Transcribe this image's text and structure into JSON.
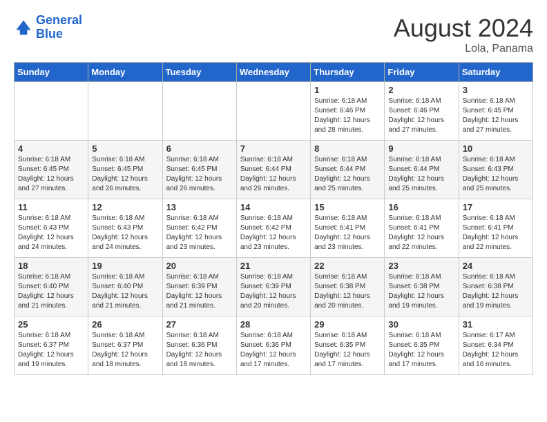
{
  "header": {
    "logo_line1": "General",
    "logo_line2": "Blue",
    "month": "August 2024",
    "location": "Lola, Panama"
  },
  "days_of_week": [
    "Sunday",
    "Monday",
    "Tuesday",
    "Wednesday",
    "Thursday",
    "Friday",
    "Saturday"
  ],
  "weeks": [
    [
      {
        "day": "",
        "info": ""
      },
      {
        "day": "",
        "info": ""
      },
      {
        "day": "",
        "info": ""
      },
      {
        "day": "",
        "info": ""
      },
      {
        "day": "1",
        "info": "Sunrise: 6:18 AM\nSunset: 6:46 PM\nDaylight: 12 hours\nand 28 minutes."
      },
      {
        "day": "2",
        "info": "Sunrise: 6:18 AM\nSunset: 6:46 PM\nDaylight: 12 hours\nand 27 minutes."
      },
      {
        "day": "3",
        "info": "Sunrise: 6:18 AM\nSunset: 6:45 PM\nDaylight: 12 hours\nand 27 minutes."
      }
    ],
    [
      {
        "day": "4",
        "info": "Sunrise: 6:18 AM\nSunset: 6:45 PM\nDaylight: 12 hours\nand 27 minutes."
      },
      {
        "day": "5",
        "info": "Sunrise: 6:18 AM\nSunset: 6:45 PM\nDaylight: 12 hours\nand 26 minutes."
      },
      {
        "day": "6",
        "info": "Sunrise: 6:18 AM\nSunset: 6:45 PM\nDaylight: 12 hours\nand 26 minutes."
      },
      {
        "day": "7",
        "info": "Sunrise: 6:18 AM\nSunset: 6:44 PM\nDaylight: 12 hours\nand 26 minutes."
      },
      {
        "day": "8",
        "info": "Sunrise: 6:18 AM\nSunset: 6:44 PM\nDaylight: 12 hours\nand 25 minutes."
      },
      {
        "day": "9",
        "info": "Sunrise: 6:18 AM\nSunset: 6:44 PM\nDaylight: 12 hours\nand 25 minutes."
      },
      {
        "day": "10",
        "info": "Sunrise: 6:18 AM\nSunset: 6:43 PM\nDaylight: 12 hours\nand 25 minutes."
      }
    ],
    [
      {
        "day": "11",
        "info": "Sunrise: 6:18 AM\nSunset: 6:43 PM\nDaylight: 12 hours\nand 24 minutes."
      },
      {
        "day": "12",
        "info": "Sunrise: 6:18 AM\nSunset: 6:43 PM\nDaylight: 12 hours\nand 24 minutes."
      },
      {
        "day": "13",
        "info": "Sunrise: 6:18 AM\nSunset: 6:42 PM\nDaylight: 12 hours\nand 23 minutes."
      },
      {
        "day": "14",
        "info": "Sunrise: 6:18 AM\nSunset: 6:42 PM\nDaylight: 12 hours\nand 23 minutes."
      },
      {
        "day": "15",
        "info": "Sunrise: 6:18 AM\nSunset: 6:41 PM\nDaylight: 12 hours\nand 23 minutes."
      },
      {
        "day": "16",
        "info": "Sunrise: 6:18 AM\nSunset: 6:41 PM\nDaylight: 12 hours\nand 22 minutes."
      },
      {
        "day": "17",
        "info": "Sunrise: 6:18 AM\nSunset: 6:41 PM\nDaylight: 12 hours\nand 22 minutes."
      }
    ],
    [
      {
        "day": "18",
        "info": "Sunrise: 6:18 AM\nSunset: 6:40 PM\nDaylight: 12 hours\nand 21 minutes."
      },
      {
        "day": "19",
        "info": "Sunrise: 6:18 AM\nSunset: 6:40 PM\nDaylight: 12 hours\nand 21 minutes."
      },
      {
        "day": "20",
        "info": "Sunrise: 6:18 AM\nSunset: 6:39 PM\nDaylight: 12 hours\nand 21 minutes."
      },
      {
        "day": "21",
        "info": "Sunrise: 6:18 AM\nSunset: 6:39 PM\nDaylight: 12 hours\nand 20 minutes."
      },
      {
        "day": "22",
        "info": "Sunrise: 6:18 AM\nSunset: 6:38 PM\nDaylight: 12 hours\nand 20 minutes."
      },
      {
        "day": "23",
        "info": "Sunrise: 6:18 AM\nSunset: 6:38 PM\nDaylight: 12 hours\nand 19 minutes."
      },
      {
        "day": "24",
        "info": "Sunrise: 6:18 AM\nSunset: 6:38 PM\nDaylight: 12 hours\nand 19 minutes."
      }
    ],
    [
      {
        "day": "25",
        "info": "Sunrise: 6:18 AM\nSunset: 6:37 PM\nDaylight: 12 hours\nand 19 minutes."
      },
      {
        "day": "26",
        "info": "Sunrise: 6:18 AM\nSunset: 6:37 PM\nDaylight: 12 hours\nand 18 minutes."
      },
      {
        "day": "27",
        "info": "Sunrise: 6:18 AM\nSunset: 6:36 PM\nDaylight: 12 hours\nand 18 minutes."
      },
      {
        "day": "28",
        "info": "Sunrise: 6:18 AM\nSunset: 6:36 PM\nDaylight: 12 hours\nand 17 minutes."
      },
      {
        "day": "29",
        "info": "Sunrise: 6:18 AM\nSunset: 6:35 PM\nDaylight: 12 hours\nand 17 minutes."
      },
      {
        "day": "30",
        "info": "Sunrise: 6:18 AM\nSunset: 6:35 PM\nDaylight: 12 hours\nand 17 minutes."
      },
      {
        "day": "31",
        "info": "Sunrise: 6:17 AM\nSunset: 6:34 PM\nDaylight: 12 hours\nand 16 minutes."
      }
    ]
  ]
}
